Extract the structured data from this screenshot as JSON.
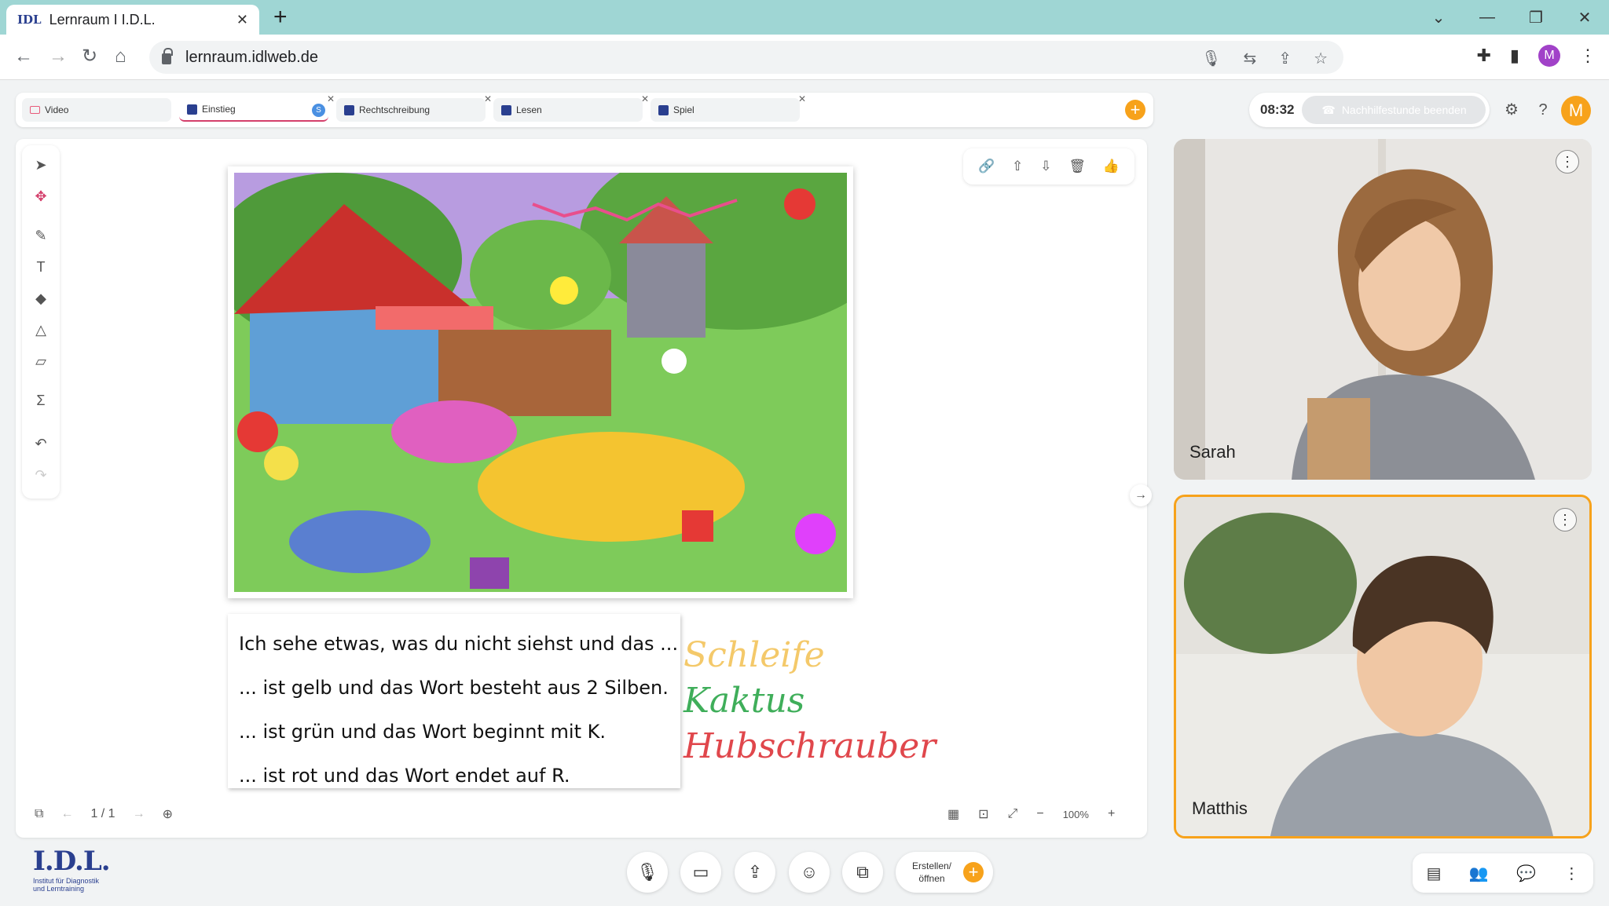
{
  "browser": {
    "tab_title": "Lernraum I I.D.L.",
    "tab_favicon": "IDL",
    "url": "lernraum.idlweb.de",
    "profile_initial": "M"
  },
  "whiteboard_tabs": [
    {
      "label": "Video"
    },
    {
      "label": "Einstieg",
      "badge": "S"
    },
    {
      "label": "Rechtschreibung"
    },
    {
      "label": "Lesen"
    },
    {
      "label": "Spiel"
    }
  ],
  "session": {
    "timer": "08:32",
    "end_label": "Nachhilfestunde beenden",
    "user_initial": "M"
  },
  "exercise": {
    "lines": [
      "Ich sehe etwas, was du nicht siehst und das ...",
      "... ist gelb und das Wort besteht aus 2 Silben.",
      "... ist grün und das Wort beginnt mit K.",
      "... ist rot und das Wort endet auf R."
    ],
    "answers": [
      {
        "text": "Schleife",
        "color": "#f4c96a"
      },
      {
        "text": "Kaktus",
        "color": "#3fae5a"
      },
      {
        "text": "Hubschrauber",
        "color": "#e0474c"
      }
    ]
  },
  "pager": {
    "page": "1 / 1"
  },
  "zoom": {
    "level": "100%"
  },
  "participants": [
    {
      "name": "Sarah"
    },
    {
      "name": "Matthis"
    }
  ],
  "create_button": {
    "label": "Erstellen/ öffnen"
  },
  "logo": {
    "text": "I.D.L.",
    "subtitle": "Institut für Diagnostik und Lerntraining"
  },
  "colors": {
    "accent": "#f7a21b",
    "active_tab": "#d43f6b",
    "brand": "#2a3f8f"
  }
}
